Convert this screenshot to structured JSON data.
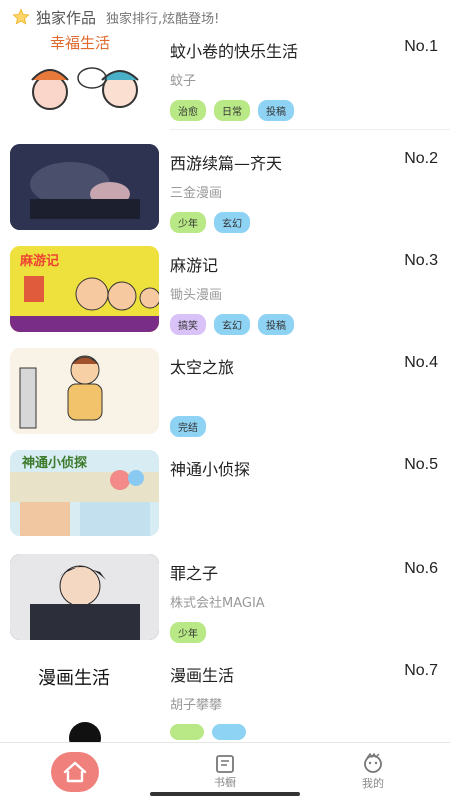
{
  "header": {
    "title": "独家作品",
    "subtitle": "独家排行,炫酷登场!",
    "icon": "star-icon"
  },
  "items": [
    {
      "name": "蚊小卷的快乐生活",
      "rank": "No.1",
      "author": "蚊子",
      "tags": [
        "治愈",
        "日常",
        "投稿"
      ],
      "thumb_text": "幸福生活"
    },
    {
      "name": "西游续篇—齐天",
      "rank": "No.2",
      "author": "三金漫画",
      "tags": [
        "少年",
        "玄幻"
      ]
    },
    {
      "name": "麻游记",
      "rank": "No.3",
      "author": "锄头漫画",
      "tags": [
        "搞笑",
        "玄幻",
        "投稿"
      ],
      "thumb_text": "麻游记"
    },
    {
      "name": "太空之旅",
      "rank": "No.4",
      "author": "",
      "tags": [
        "完结"
      ]
    },
    {
      "name": "神通小侦探",
      "rank": "No.5",
      "author": "",
      "tags": [],
      "thumb_text": "神通小侦探"
    },
    {
      "name": "罪之子",
      "rank": "No.6",
      "author": "株式会社MAGIA",
      "tags": [
        "少年"
      ]
    },
    {
      "name": "漫画生活",
      "rank": "No.7",
      "author": "胡子攀攀",
      "tags": [],
      "thumb_text": "漫画生活"
    }
  ],
  "tabbar": {
    "home_icon": "home-icon",
    "shelf_label": "书橱",
    "shelf_icon": "bookshelf-icon",
    "mine_label": "我的",
    "mine_icon": "profile-icon"
  },
  "colors": {
    "accent": "#f0807b",
    "tag_green": "#b8e986",
    "tag_blue": "#8fd3f4",
    "tag_purple": "#d9c2f7"
  }
}
